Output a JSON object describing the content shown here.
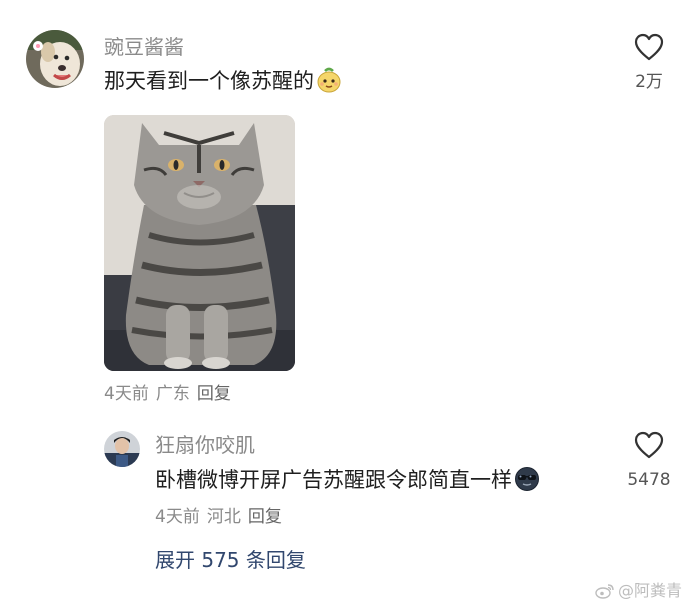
{
  "comments": [
    {
      "username": "豌豆酱酱",
      "text": "那天看到一个像苏醒的",
      "emoji": "face-emoji",
      "time": "4天前",
      "location": "广东",
      "reply_label": "回复",
      "likes": "2万",
      "has_image": true
    },
    {
      "username": "狂扇你咬肌",
      "text": "卧槽微博开屏广告苏醒跟令郎简直一样",
      "emoji": "sunglasses-emoji",
      "time": "4天前",
      "location": "河北",
      "reply_label": "回复",
      "likes": "5478"
    }
  ],
  "expand_replies": "展开 575 条回复",
  "watermark": "@阿粪青",
  "icons": {
    "like": "heart-outline-icon",
    "watermark": "weibo-logo-icon"
  },
  "colors": {
    "username": "#8a8a8a",
    "text": "#1f1f1f",
    "expand_link": "#31476e",
    "meta": "#8a8a8a"
  }
}
